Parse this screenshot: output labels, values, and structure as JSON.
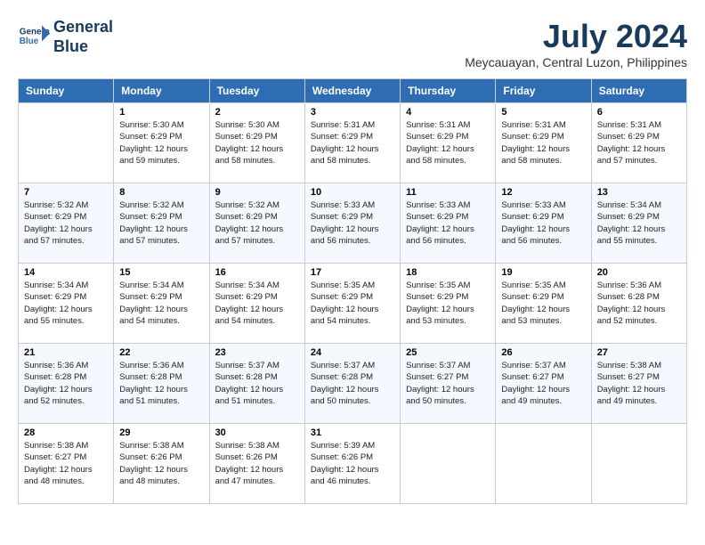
{
  "logo": {
    "line1": "General",
    "line2": "Blue"
  },
  "title": "July 2024",
  "location": "Meycauayan, Central Luzon, Philippines",
  "days_of_week": [
    "Sunday",
    "Monday",
    "Tuesday",
    "Wednesday",
    "Thursday",
    "Friday",
    "Saturday"
  ],
  "weeks": [
    [
      {
        "num": "",
        "info": ""
      },
      {
        "num": "1",
        "info": "Sunrise: 5:30 AM\nSunset: 6:29 PM\nDaylight: 12 hours\nand 59 minutes."
      },
      {
        "num": "2",
        "info": "Sunrise: 5:30 AM\nSunset: 6:29 PM\nDaylight: 12 hours\nand 58 minutes."
      },
      {
        "num": "3",
        "info": "Sunrise: 5:31 AM\nSunset: 6:29 PM\nDaylight: 12 hours\nand 58 minutes."
      },
      {
        "num": "4",
        "info": "Sunrise: 5:31 AM\nSunset: 6:29 PM\nDaylight: 12 hours\nand 58 minutes."
      },
      {
        "num": "5",
        "info": "Sunrise: 5:31 AM\nSunset: 6:29 PM\nDaylight: 12 hours\nand 58 minutes."
      },
      {
        "num": "6",
        "info": "Sunrise: 5:31 AM\nSunset: 6:29 PM\nDaylight: 12 hours\nand 57 minutes."
      }
    ],
    [
      {
        "num": "7",
        "info": "Sunrise: 5:32 AM\nSunset: 6:29 PM\nDaylight: 12 hours\nand 57 minutes."
      },
      {
        "num": "8",
        "info": "Sunrise: 5:32 AM\nSunset: 6:29 PM\nDaylight: 12 hours\nand 57 minutes."
      },
      {
        "num": "9",
        "info": "Sunrise: 5:32 AM\nSunset: 6:29 PM\nDaylight: 12 hours\nand 57 minutes."
      },
      {
        "num": "10",
        "info": "Sunrise: 5:33 AM\nSunset: 6:29 PM\nDaylight: 12 hours\nand 56 minutes."
      },
      {
        "num": "11",
        "info": "Sunrise: 5:33 AM\nSunset: 6:29 PM\nDaylight: 12 hours\nand 56 minutes."
      },
      {
        "num": "12",
        "info": "Sunrise: 5:33 AM\nSunset: 6:29 PM\nDaylight: 12 hours\nand 56 minutes."
      },
      {
        "num": "13",
        "info": "Sunrise: 5:34 AM\nSunset: 6:29 PM\nDaylight: 12 hours\nand 55 minutes."
      }
    ],
    [
      {
        "num": "14",
        "info": "Sunrise: 5:34 AM\nSunset: 6:29 PM\nDaylight: 12 hours\nand 55 minutes."
      },
      {
        "num": "15",
        "info": "Sunrise: 5:34 AM\nSunset: 6:29 PM\nDaylight: 12 hours\nand 54 minutes."
      },
      {
        "num": "16",
        "info": "Sunrise: 5:34 AM\nSunset: 6:29 PM\nDaylight: 12 hours\nand 54 minutes."
      },
      {
        "num": "17",
        "info": "Sunrise: 5:35 AM\nSunset: 6:29 PM\nDaylight: 12 hours\nand 54 minutes."
      },
      {
        "num": "18",
        "info": "Sunrise: 5:35 AM\nSunset: 6:29 PM\nDaylight: 12 hours\nand 53 minutes."
      },
      {
        "num": "19",
        "info": "Sunrise: 5:35 AM\nSunset: 6:29 PM\nDaylight: 12 hours\nand 53 minutes."
      },
      {
        "num": "20",
        "info": "Sunrise: 5:36 AM\nSunset: 6:28 PM\nDaylight: 12 hours\nand 52 minutes."
      }
    ],
    [
      {
        "num": "21",
        "info": "Sunrise: 5:36 AM\nSunset: 6:28 PM\nDaylight: 12 hours\nand 52 minutes."
      },
      {
        "num": "22",
        "info": "Sunrise: 5:36 AM\nSunset: 6:28 PM\nDaylight: 12 hours\nand 51 minutes."
      },
      {
        "num": "23",
        "info": "Sunrise: 5:37 AM\nSunset: 6:28 PM\nDaylight: 12 hours\nand 51 minutes."
      },
      {
        "num": "24",
        "info": "Sunrise: 5:37 AM\nSunset: 6:28 PM\nDaylight: 12 hours\nand 50 minutes."
      },
      {
        "num": "25",
        "info": "Sunrise: 5:37 AM\nSunset: 6:27 PM\nDaylight: 12 hours\nand 50 minutes."
      },
      {
        "num": "26",
        "info": "Sunrise: 5:37 AM\nSunset: 6:27 PM\nDaylight: 12 hours\nand 49 minutes."
      },
      {
        "num": "27",
        "info": "Sunrise: 5:38 AM\nSunset: 6:27 PM\nDaylight: 12 hours\nand 49 minutes."
      }
    ],
    [
      {
        "num": "28",
        "info": "Sunrise: 5:38 AM\nSunset: 6:27 PM\nDaylight: 12 hours\nand 48 minutes."
      },
      {
        "num": "29",
        "info": "Sunrise: 5:38 AM\nSunset: 6:26 PM\nDaylight: 12 hours\nand 48 minutes."
      },
      {
        "num": "30",
        "info": "Sunrise: 5:38 AM\nSunset: 6:26 PM\nDaylight: 12 hours\nand 47 minutes."
      },
      {
        "num": "31",
        "info": "Sunrise: 5:39 AM\nSunset: 6:26 PM\nDaylight: 12 hours\nand 46 minutes."
      },
      {
        "num": "",
        "info": ""
      },
      {
        "num": "",
        "info": ""
      },
      {
        "num": "",
        "info": ""
      }
    ]
  ]
}
